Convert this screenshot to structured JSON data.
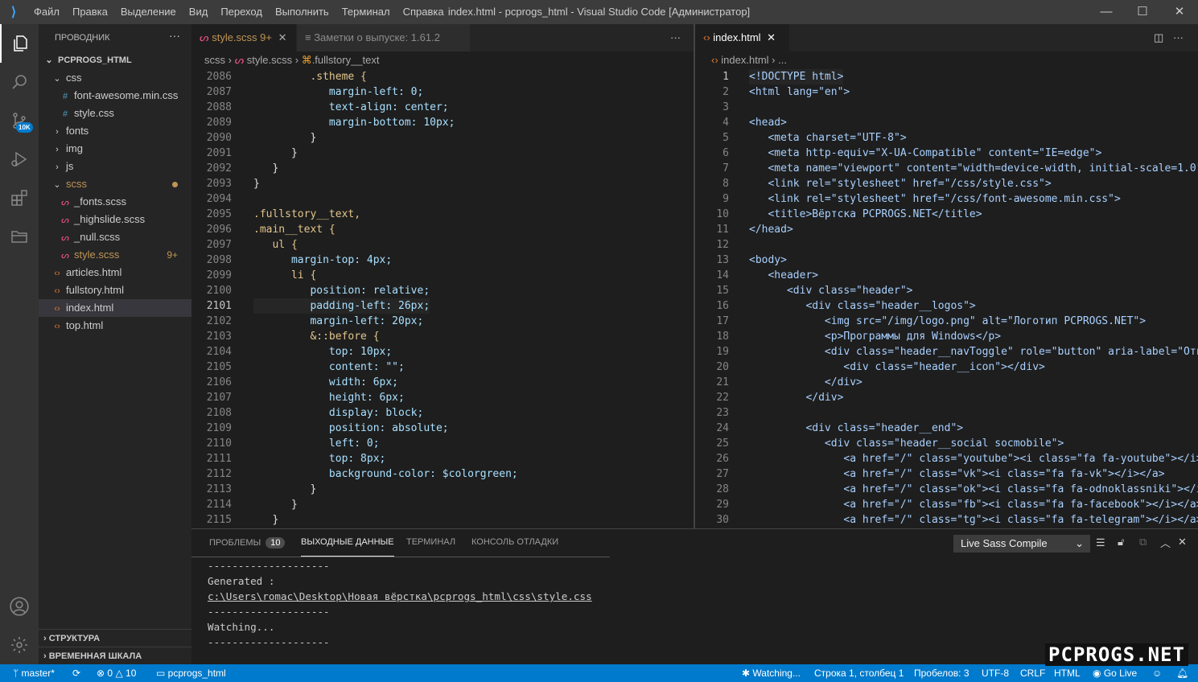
{
  "titlebar": {
    "menus": [
      "Файл",
      "Правка",
      "Выделение",
      "Вид",
      "Переход",
      "Выполнить",
      "Терминал",
      "Справка"
    ],
    "title": "index.html - pcprogs_html - Visual Studio Code [Администратор]"
  },
  "activity": {
    "source_control_badge": "10K"
  },
  "sidebar": {
    "title": "ПРОВОДНИК",
    "root": "PCPROGS_HTML",
    "items": [
      {
        "label": "css",
        "type": "folder-open",
        "depth": 1
      },
      {
        "label": "font-awesome.min.css",
        "type": "css",
        "depth": 2
      },
      {
        "label": "style.css",
        "type": "css",
        "depth": 2
      },
      {
        "label": "fonts",
        "type": "folder",
        "depth": 1
      },
      {
        "label": "img",
        "type": "folder",
        "depth": 1
      },
      {
        "label": "js",
        "type": "folder",
        "depth": 1
      },
      {
        "label": "scss",
        "type": "folder-open",
        "depth": 1,
        "modified": true
      },
      {
        "label": "_fonts.scss",
        "type": "scss",
        "depth": 2
      },
      {
        "label": "_highslide.scss",
        "type": "scss",
        "depth": 2
      },
      {
        "label": "_null.scss",
        "type": "scss",
        "depth": 2
      },
      {
        "label": "style.scss",
        "type": "scss",
        "depth": 2,
        "count": "9+"
      },
      {
        "label": "articles.html",
        "type": "html",
        "depth": 1
      },
      {
        "label": "fullstory.html",
        "type": "html",
        "depth": 1
      },
      {
        "label": "index.html",
        "type": "html",
        "depth": 1,
        "selected": true
      },
      {
        "label": "top.html",
        "type": "html",
        "depth": 1
      }
    ],
    "sections": [
      "СТРУКТУРА",
      "ВРЕМЕННАЯ ШКАЛА"
    ]
  },
  "left_editor": {
    "tabs": [
      {
        "label": "style.scss",
        "count": "9+",
        "active": true
      },
      {
        "label": "Заметки о выпуске: 1.61.2",
        "active": false
      }
    ],
    "breadcrumb": [
      "scss",
      "style.scss",
      ".fullstory__text"
    ],
    "first_line": 2086,
    "current_line": 2101,
    "lines": [
      "         .stheme {",
      "            margin-left: 0;",
      "            text-align: center;",
      "            margin-bottom: 10px;",
      "         }",
      "      }",
      "   }",
      "}",
      "",
      ".fullstory__text,",
      ".main__text {",
      "   ul {",
      "      margin-top: 4px;",
      "      li {",
      "         position: relative;",
      "         padding-left: 26px;",
      "         margin-left: 20px;",
      "         &::before {",
      "            top: 10px;",
      "            content: \"\";",
      "            width: 6px;",
      "            height: 6px;",
      "            display: block;",
      "            position: absolute;",
      "            left: 0;",
      "            top: 8px;",
      "            background-color: $colorgreen;",
      "         }",
      "      }",
      "   }"
    ]
  },
  "right_editor": {
    "tabs": [
      {
        "label": "index.html",
        "active": true
      }
    ],
    "breadcrumb": [
      "index.html",
      "..."
    ],
    "first_line": 1,
    "current_line": 1,
    "lines": [
      "<!DOCTYPE html>",
      "<html lang=\"en\">",
      "",
      "<head>",
      "   <meta charset=\"UTF-8\">",
      "   <meta http-equiv=\"X-UA-Compatible\" content=\"IE=edge\">",
      "   <meta name=\"viewport\" content=\"width=device-width, initial-scale=1.0\">",
      "   <link rel=\"stylesheet\" href=\"/css/style.css\">",
      "   <link rel=\"stylesheet\" href=\"/css/font-awesome.min.css\">",
      "   <title>Вёртска PCPROGS.NET</title>",
      "</head>",
      "",
      "<body>",
      "   <header>",
      "      <div class=\"header\">",
      "         <div class=\"header__logos\">",
      "            <img src=\"/img/logo.png\" alt=\"Логотип PCPROGS.NET\">",
      "            <p>Программы для Windows</p>",
      "            <div class=\"header__navToggle\" role=\"button\" aria-label=\"Откр",
      "               <div class=\"header__icon\"></div>",
      "            </div>",
      "         </div>",
      "",
      "         <div class=\"header__end\">",
      "            <div class=\"header__social socmobile\">",
      "               <a href=\"/\" class=\"youtube\"><i class=\"fa fa-youtube\"></i><",
      "               <a href=\"/\" class=\"vk\"><i class=\"fa fa-vk\"></i></a>",
      "               <a href=\"/\" class=\"ok\"><i class=\"fa fa-odnoklassniki\"></i>",
      "               <a href=\"/\" class=\"fb\"><i class=\"fa fa-facebook\"></i></a>",
      "               <a href=\"/\" class=\"tg\"><i class=\"fa fa-telegram\"></i></a>"
    ]
  },
  "panel": {
    "tabs": [
      {
        "label": "ПРОБЛЕМЫ",
        "badge": "10"
      },
      {
        "label": "ВЫХОДНЫЕ ДАННЫЕ",
        "active": true
      },
      {
        "label": "ТЕРМИНАЛ"
      },
      {
        "label": "КОНСОЛЬ ОТЛАДКИ"
      }
    ],
    "output_channel": "Live Sass Compile",
    "output": [
      "--------------------",
      "Generated :",
      "c:\\Users\\romac\\Desktop\\Новая вёрстка\\pcprogs_html\\css\\style.css",
      "--------------------",
      "Watching...",
      "--------------------"
    ]
  },
  "status": {
    "branch": "master*",
    "errors": "0",
    "warnings": "10",
    "folder": "pcprogs_html",
    "watching": "Watching...",
    "position": "Строка 1, столбец 1",
    "spaces": "Пробелов: 3",
    "encoding": "UTF-8",
    "eol": "CRLF",
    "language": "HTML",
    "golive": "Go Live"
  },
  "watermark": "PCPROGS.NET",
  "colors": {
    "accent": "#007acc",
    "modified": "#c09553",
    "editor_bg": "#1e1e1e"
  }
}
